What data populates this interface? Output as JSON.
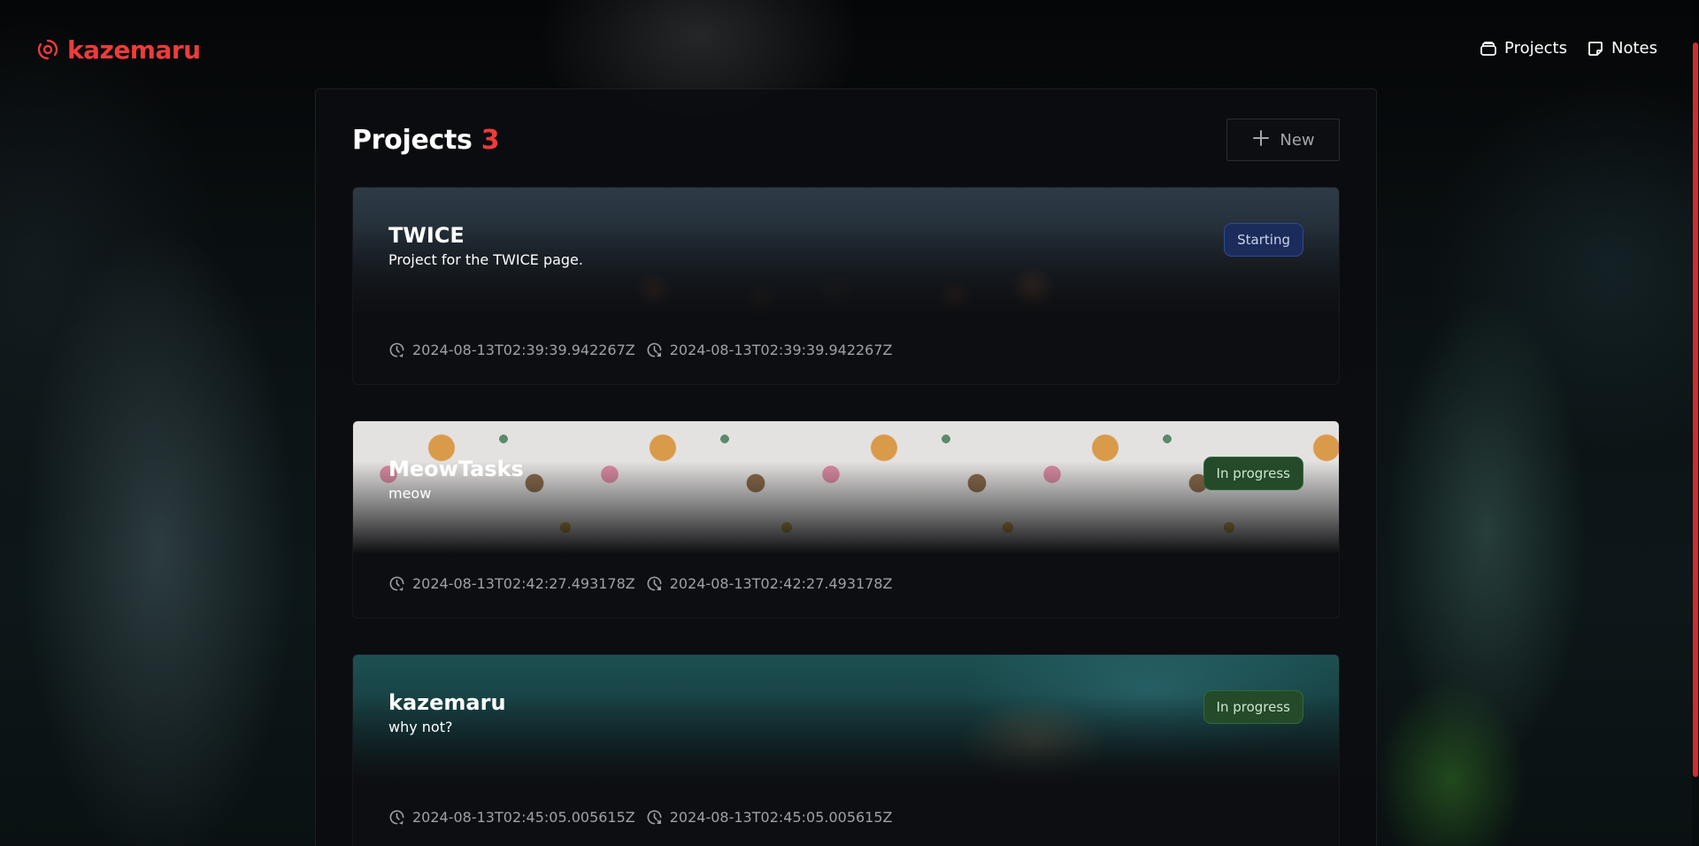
{
  "app": {
    "logo_text": "kazemaru",
    "nav": [
      {
        "label": "Projects",
        "icon": "layers-icon"
      },
      {
        "label": "Notes",
        "icon": "sticky-note-icon"
      }
    ]
  },
  "projects_panel": {
    "title": "Projects",
    "count": "3",
    "new_button_label": "New",
    "projects": [
      {
        "title": "TWICE",
        "description": "Project for the TWICE page.",
        "status": "Starting",
        "created": "2024-08-13T02:39:39.942267Z",
        "updated": "2024-08-13T02:39:39.942267Z"
      },
      {
        "title": "MeowTasks",
        "description": "meow",
        "status": "In progress",
        "created": "2024-08-13T02:42:27.493178Z",
        "updated": "2024-08-13T02:42:27.493178Z"
      },
      {
        "title": "kazemaru",
        "description": "why not?",
        "status": "In progress",
        "created": "2024-08-13T02:45:05.005615Z",
        "updated": "2024-08-13T02:45:05.005615Z"
      }
    ]
  },
  "colors": {
    "accent": "#ee3b3b",
    "status_starting": "#1b2c5a",
    "status_in_progress": "#244a2a"
  }
}
